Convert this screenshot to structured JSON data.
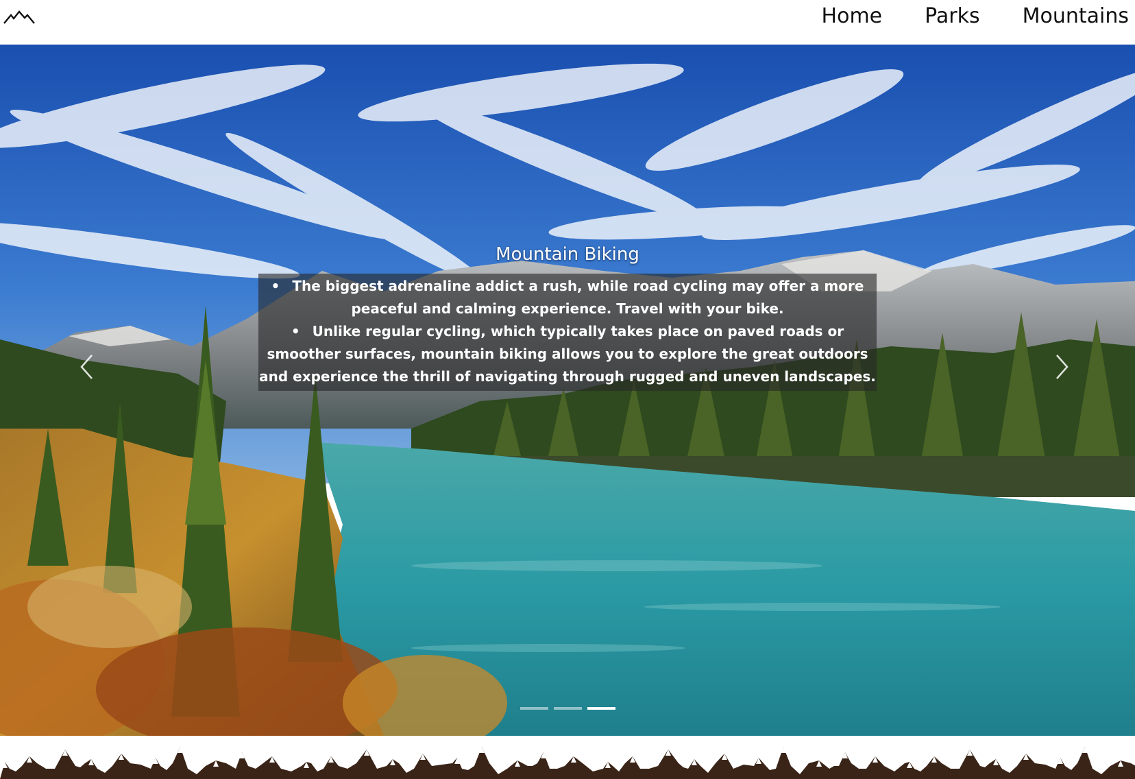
{
  "navbar": {
    "logo_icon": "mountain-logo-icon",
    "links": [
      {
        "label": "Home"
      },
      {
        "label": "Parks"
      },
      {
        "label": "Mountains"
      }
    ]
  },
  "carousel": {
    "title": "Mountain Biking",
    "bullets": [
      "The biggest adrenaline addict a rush, while road cycling may offer a more peaceful and calming experience. Travel with your bike.",
      "Unlike regular cycling, which typically takes place on paved roads or smoother surfaces, mountain biking allows you to explore the great outdoors and experience the thrill of navigating through rugged and uneven landscapes."
    ],
    "prev_icon": "chevron-left-icon",
    "next_icon": "chevron-right-icon",
    "indicator_count": 3,
    "active_indicator": 3
  },
  "footer": {
    "decoration_icon": "mountain-range-border"
  },
  "colors": {
    "sky": "#2a64c0",
    "lake": "#2a9aa4",
    "forest": "#2e4a1e",
    "mountain_border": "#3a2418"
  }
}
